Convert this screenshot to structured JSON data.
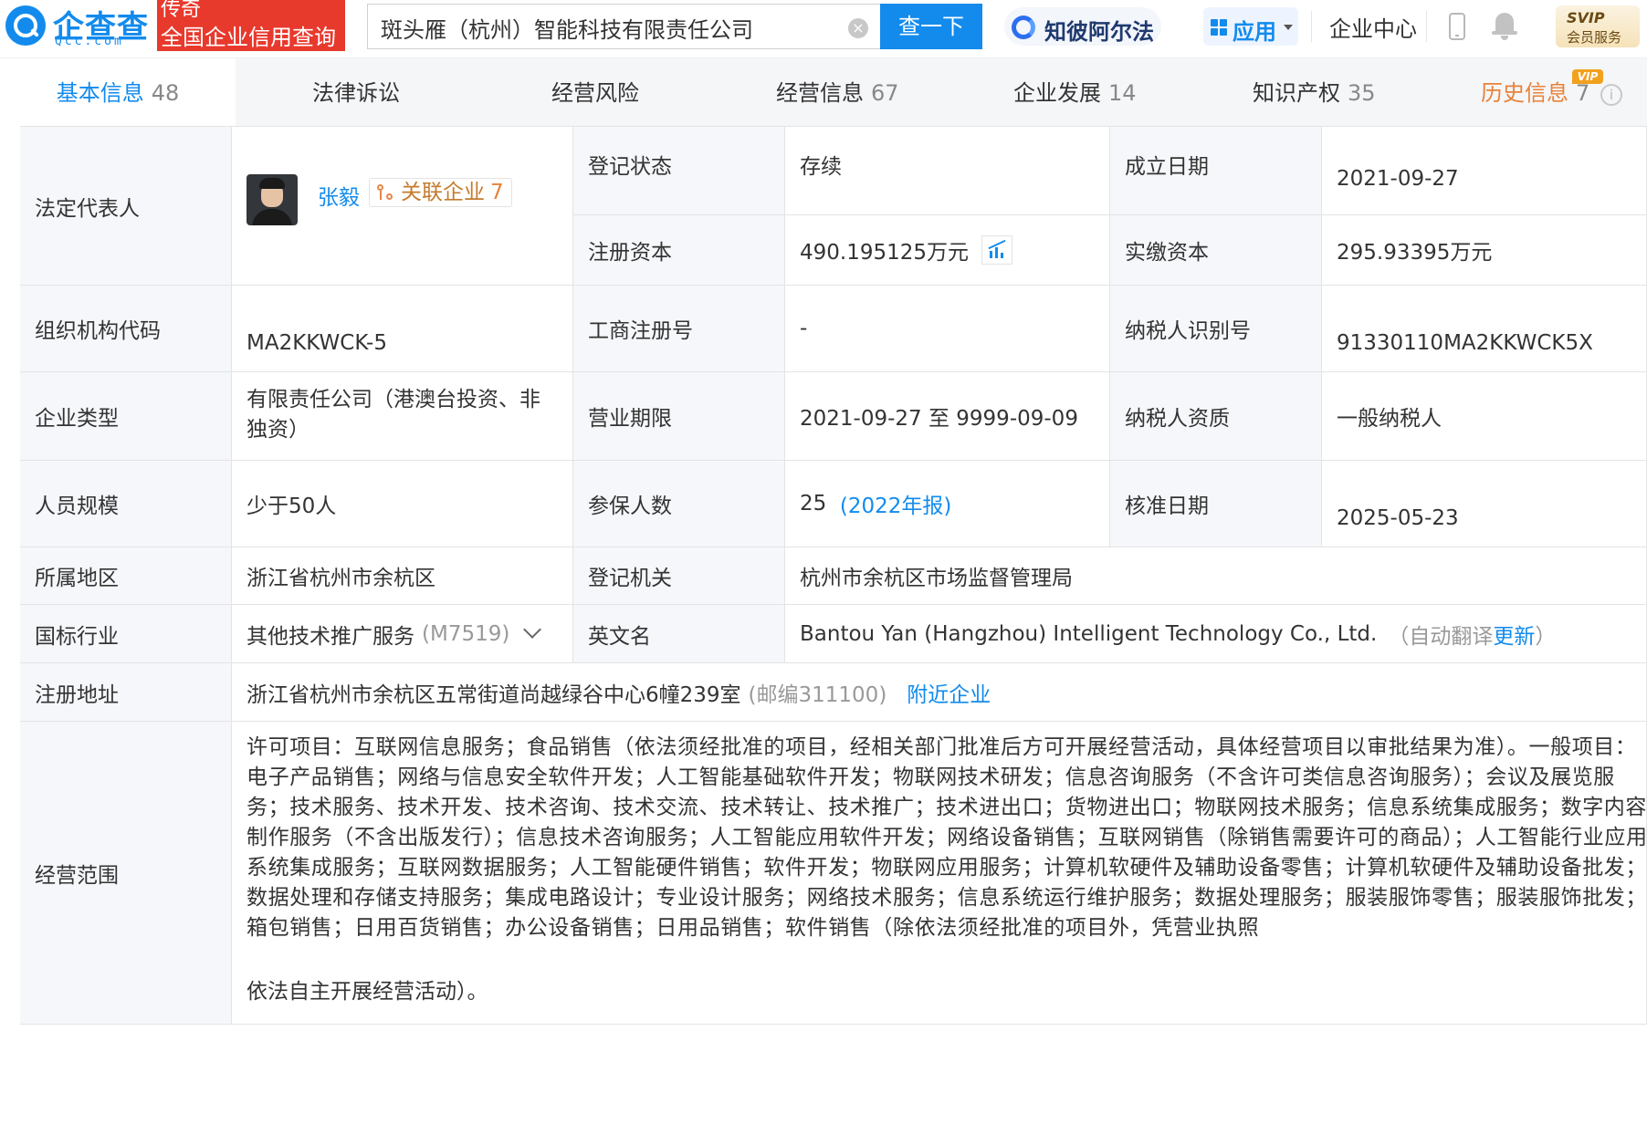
{
  "header": {
    "logo": {
      "name": "企查查",
      "sub": "Qcc.com"
    },
    "badge": {
      "line1": "传奇",
      "line2": "全国企业信用查询"
    },
    "search": {
      "value": "斑头雁（杭州）智能科技有限责任公司",
      "button": "查一下"
    },
    "zhibi": "知彼阿尔法",
    "app_menu": "应用",
    "enterprise_center": "企业中心",
    "svip": {
      "line1": "SVIP",
      "line2": "会员服务"
    }
  },
  "tabs": [
    {
      "label": "基本信息",
      "count": "48"
    },
    {
      "label": "法律诉讼",
      "count": ""
    },
    {
      "label": "经营风险",
      "count": ""
    },
    {
      "label": "经营信息",
      "count": "67"
    },
    {
      "label": "企业发展",
      "count": "14"
    },
    {
      "label": "知识产权",
      "count": "35"
    },
    {
      "label": "历史信息",
      "count": "7",
      "tag": "VIP"
    }
  ],
  "info": {
    "legal_rep": {
      "label": "法定代表人",
      "name": "张毅",
      "related_label": "关联企业",
      "related_count": "7"
    },
    "reg_status": {
      "label": "登记状态",
      "value": "存续"
    },
    "found_date": {
      "label": "成立日期",
      "value": "2021-09-27"
    },
    "reg_capital": {
      "label": "注册资本",
      "value": "490.195125万元"
    },
    "paid_capital": {
      "label": "实缴资本",
      "value": "295.93395万元"
    },
    "org_code": {
      "label": "组织机构代码",
      "value": "MA2KKWCK-5"
    },
    "biz_reg_no": {
      "label": "工商注册号",
      "value": "-"
    },
    "taxpayer_id": {
      "label": "纳税人识别号",
      "value": "91330110MA2KKWCK5X"
    },
    "ent_type": {
      "label": "企业类型",
      "value": "有限责任公司（港澳台投资、非独资）"
    },
    "biz_term": {
      "label": "营业期限",
      "value": "2021-09-27 至 9999-09-09"
    },
    "taxpayer_qual": {
      "label": "纳税人资质",
      "value": "一般纳税人"
    },
    "staff_size": {
      "label": "人员规模",
      "value": "少于50人"
    },
    "insured": {
      "label": "参保人数",
      "value": "25",
      "report": "(2022年报)"
    },
    "approve_date": {
      "label": "核准日期",
      "value": "2025-05-23"
    },
    "region": {
      "label": "所属地区",
      "value": "浙江省杭州市余杭区"
    },
    "reg_authority": {
      "label": "登记机关",
      "value": "杭州市余杭区市场监督管理局"
    },
    "industry": {
      "label": "国标行业",
      "value": "其他技术推广服务",
      "code": "(M7519)"
    },
    "english_name": {
      "label": "英文名",
      "value": "Bantou Yan (Hangzhou) Intelligent Technology Co., Ltd.",
      "note_prefix": "（自动翻译",
      "note_link": "更新",
      "note_suffix": "）"
    },
    "reg_address": {
      "label": "注册地址",
      "value": "浙江省杭州市余杭区五常街道尚越绿谷中心6幢239室",
      "zip": "(邮编311100)",
      "nearby": "附近企业"
    },
    "scope": {
      "label": "经营范围",
      "text": "许可项目：互联网信息服务；食品销售（依法须经批准的项目，经相关部门批准后方可开展经营活动，具体经营项目以审批结果为准）。一般项目：电子产品销售；网络与信息安全软件开发；人工智能基础软件开发；物联网技术研发；信息咨询服务（不含许可类信息咨询服务）；会议及展览服务；技术服务、技术开发、技术咨询、技术交流、技术转让、技术推广；技术进出口；货物进出口；物联网技术服务；信息系统集成服务；数字内容制作服务（不含出版发行）；信息技术咨询服务；人工智能应用软件开发；网络设备销售；互联网销售（除销售需要许可的商品）；人工智能行业应用系统集成服务；互联网数据服务；人工智能硬件销售；软件开发；物联网应用服务；计算机软硬件及辅助设备零售；计算机软硬件及辅助设备批发；数据处理和存储支持服务；集成电路设计；专业设计服务；网络技术服务；信息系统运行维护服务；数据处理服务；服装服饰零售；服装服饰批发；箱包销售；日用百货销售；办公设备销售；日用品销售；软件销售（除依法须经批准的项目外，凭营业执照",
      "tail": "依法自主开展经营活动）。"
    }
  }
}
